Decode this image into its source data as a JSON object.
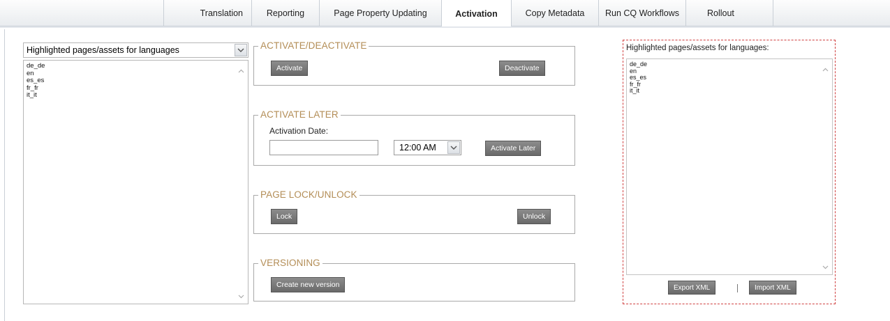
{
  "tabs": [
    {
      "label": "Translation"
    },
    {
      "label": "Reporting"
    },
    {
      "label": "Page Property Updating"
    },
    {
      "label": "Activation"
    },
    {
      "label": "Copy Metadata"
    },
    {
      "label": "Run CQ Workflows"
    },
    {
      "label": "Rollout"
    }
  ],
  "active_tab": "Activation",
  "left_panel": {
    "select_value": "Highlighted pages/assets for languages",
    "languages": [
      "de_de",
      "en",
      "es_es",
      "fr_fr",
      "it_it"
    ]
  },
  "activate_deactivate": {
    "legend": "ACTIVATE/DEACTIVATE",
    "activate_label": "Activate",
    "deactivate_label": "Deactivate"
  },
  "activate_later": {
    "legend": "ACTIVATE LATER",
    "date_label": "Activation Date:",
    "date_value": "",
    "time_value": "12:00 AM",
    "button_label": "Activate Later"
  },
  "page_lock": {
    "legend": "PAGE LOCK/UNLOCK",
    "lock_label": "Lock",
    "unlock_label": "Unlock"
  },
  "versioning": {
    "legend": "VERSIONING",
    "create_label": "Create new version"
  },
  "right_panel": {
    "label": "Highlighted pages/assets for languages:",
    "languages": [
      "de_de",
      "en",
      "es_es",
      "fr_fr",
      "it_it"
    ],
    "export_label": "Export XML",
    "import_label": "Import XML"
  },
  "colors": {
    "legend": "#b38d56",
    "button": "#7a7a7a",
    "dashed_border": "#d04040"
  },
  "icons": {
    "dropdown": "chevron-down-icon",
    "scroll_up": "chevron-up-icon",
    "scroll_down": "chevron-down-icon"
  }
}
